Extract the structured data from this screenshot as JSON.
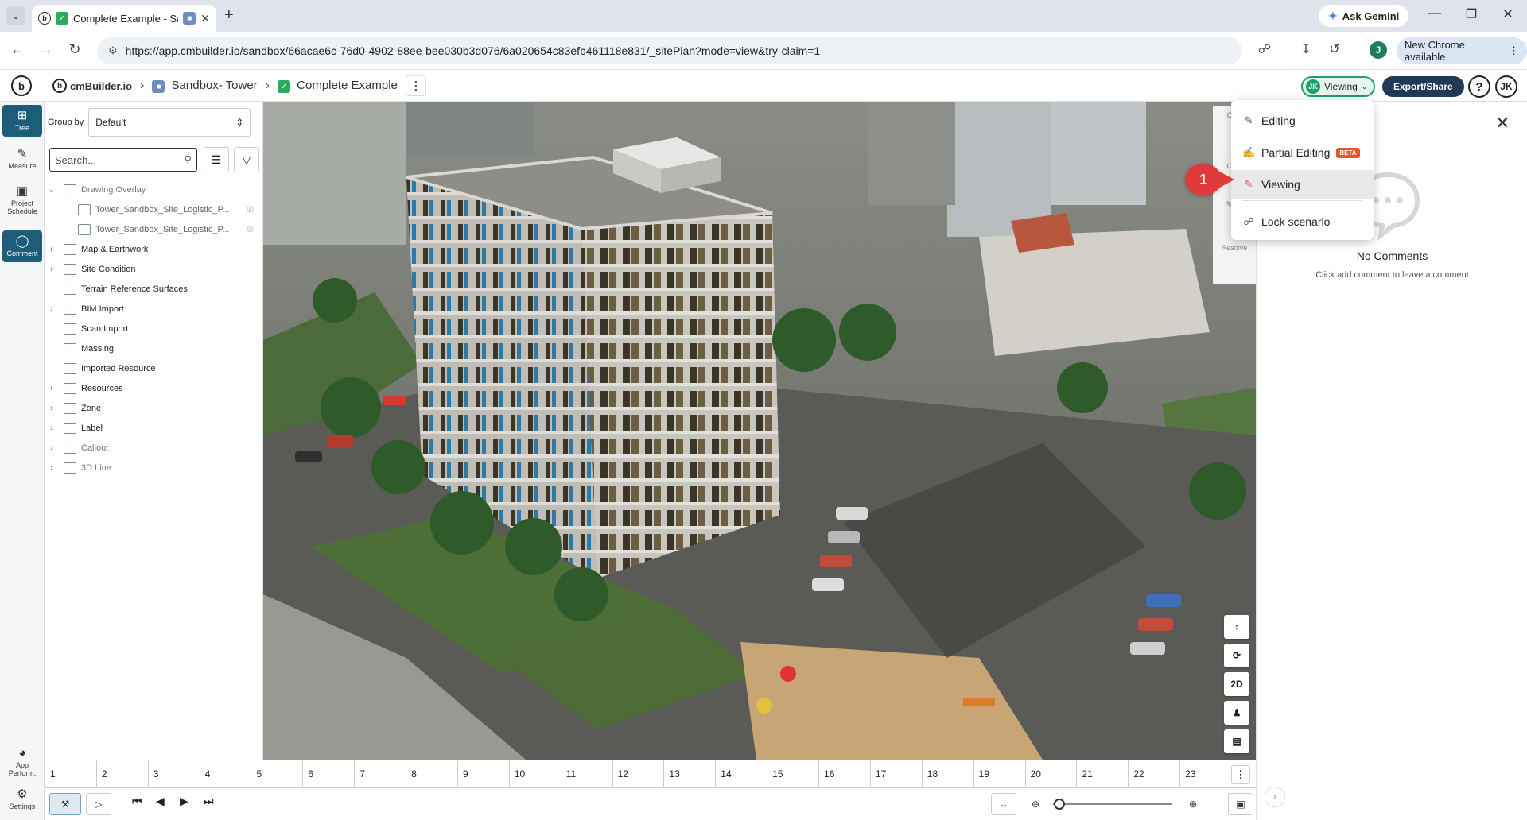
{
  "browser": {
    "tab_title": "Complete Example - Sa",
    "url": "https://app.cmbuilder.io/sandbox/66acae6c-76d0-4902-88ee-bee030b3d076/6a020654c83efb461118e831/_sitePlan?mode=view&try-claim=1",
    "gemini_label": "Ask Gemini",
    "profile_initial": "J",
    "new_chrome_label": "New Chrome available"
  },
  "header": {
    "brand": "cmBuilder.io",
    "breadcrumb_project": "Sandbox- Tower",
    "breadcrumb_scenario": "Complete Example",
    "mode_avatar": "JK",
    "mode_label": "Viewing",
    "export_label": "Export/Share",
    "user_initials": "JK",
    "help_label": "?"
  },
  "rail": {
    "tree": "Tree",
    "measure": "Measure",
    "project_schedule": "Project Schedule",
    "comment": "Comment",
    "app_perform": "App Perform.",
    "settings": "Settings"
  },
  "tree_panel": {
    "group_by_label": "Group by",
    "group_by_value": "Default",
    "search_placeholder": "Search...",
    "items": [
      {
        "label": "Drawing Overlay",
        "expanded": true,
        "dim": true
      },
      {
        "label": "Tower_Sandbox_Site_Logistic_P...",
        "child": true
      },
      {
        "label": "Tower_Sandbox_Site_Logistic_P...",
        "child": true
      },
      {
        "label": "Map & Earthwork",
        "expandable": true
      },
      {
        "label": "Site Condition",
        "expandable": true
      },
      {
        "label": "Terrain Reference Surfaces"
      },
      {
        "label": "BIM Import",
        "expandable": true
      },
      {
        "label": "Scan Import"
      },
      {
        "label": "Massing"
      },
      {
        "label": "Imported Resource"
      },
      {
        "label": "Resources",
        "expandable": true
      },
      {
        "label": "Zone",
        "expandable": true
      },
      {
        "label": "Label",
        "expandable": true
      },
      {
        "label": "Callout",
        "expandable": true,
        "dim": true
      },
      {
        "label": "3D Line",
        "expandable": true,
        "dim": true
      }
    ]
  },
  "mode_menu": {
    "editing": "Editing",
    "partial_editing": "Partial Editing",
    "beta": "BETA",
    "viewing": "Viewing",
    "lock_scenario": "Lock scenario",
    "step_number": "1"
  },
  "viewport": {
    "side_labels": [
      "Com",
      "Com",
      "Reply",
      "Resolve"
    ],
    "ctrl_2d": "2D"
  },
  "comments": {
    "title": "No Comments",
    "subtitle": "Click add comment to leave a comment"
  },
  "timeline": {
    "ticks": [
      "1",
      "2",
      "3",
      "4",
      "5",
      "6",
      "7",
      "8",
      "9",
      "10",
      "11",
      "12",
      "13",
      "14",
      "15",
      "16",
      "17",
      "18",
      "19",
      "20",
      "21",
      "22",
      "23"
    ]
  },
  "zoom_level": 0.05
}
